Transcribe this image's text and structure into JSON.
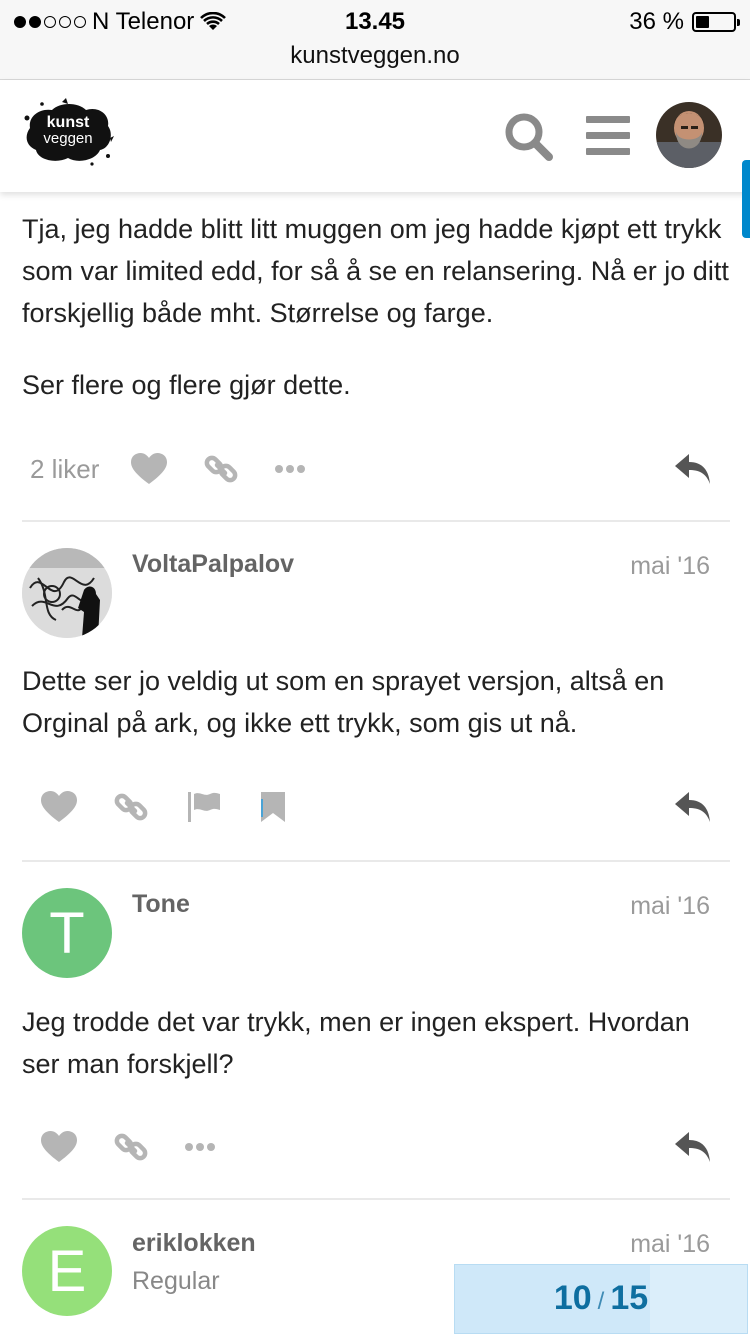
{
  "status_bar": {
    "carrier": "N Telenor",
    "time": "13.45",
    "battery": "36 %",
    "battery_level": 0.36,
    "signal_bars": 2,
    "url": "kunstveggen.no"
  },
  "header": {
    "logo_text": [
      "kunst",
      "veggen"
    ],
    "icons": [
      "search-icon",
      "hamburger-menu-icon",
      "user-avatar"
    ]
  },
  "posts": [
    {
      "paragraphs": [
        "Tja, jeg hadde blitt litt muggen om jeg hadde kjøpt ett trykk som var limited edd, for så å se en relansering. Nå er jo ditt forskjellig både mht. Størrelse og farge.",
        "Ser flere og flere gjør dette."
      ],
      "likes": "2 liker"
    },
    {
      "username": "VoltaPalpalov",
      "date": "mai '16",
      "paragraphs": [
        "Dette ser jo veldig ut som en sprayet versjon, altså en Orginal på ark, og ikke ett trykk, som gis ut nå."
      ]
    },
    {
      "username": "Tone",
      "date": "mai '16",
      "avatar_letter": "T",
      "avatar_color": "#6cc57c",
      "paragraphs": [
        "Jeg trodde det var trykk, men er ingen ekspert. Hvordan ser man forskjell?"
      ]
    },
    {
      "username": "eriklokken",
      "user_title": "Regular",
      "date": "mai '16",
      "avatar_letter": "E",
      "avatar_color": "#95e07a"
    }
  ],
  "progress": {
    "current": "10",
    "separator": "/",
    "total": "15",
    "fraction": 0.6667
  },
  "colors": {
    "accent": "#0088cc",
    "icon_gray": "#8a8a8a",
    "icon_light_gray": "#b5b5b5"
  }
}
